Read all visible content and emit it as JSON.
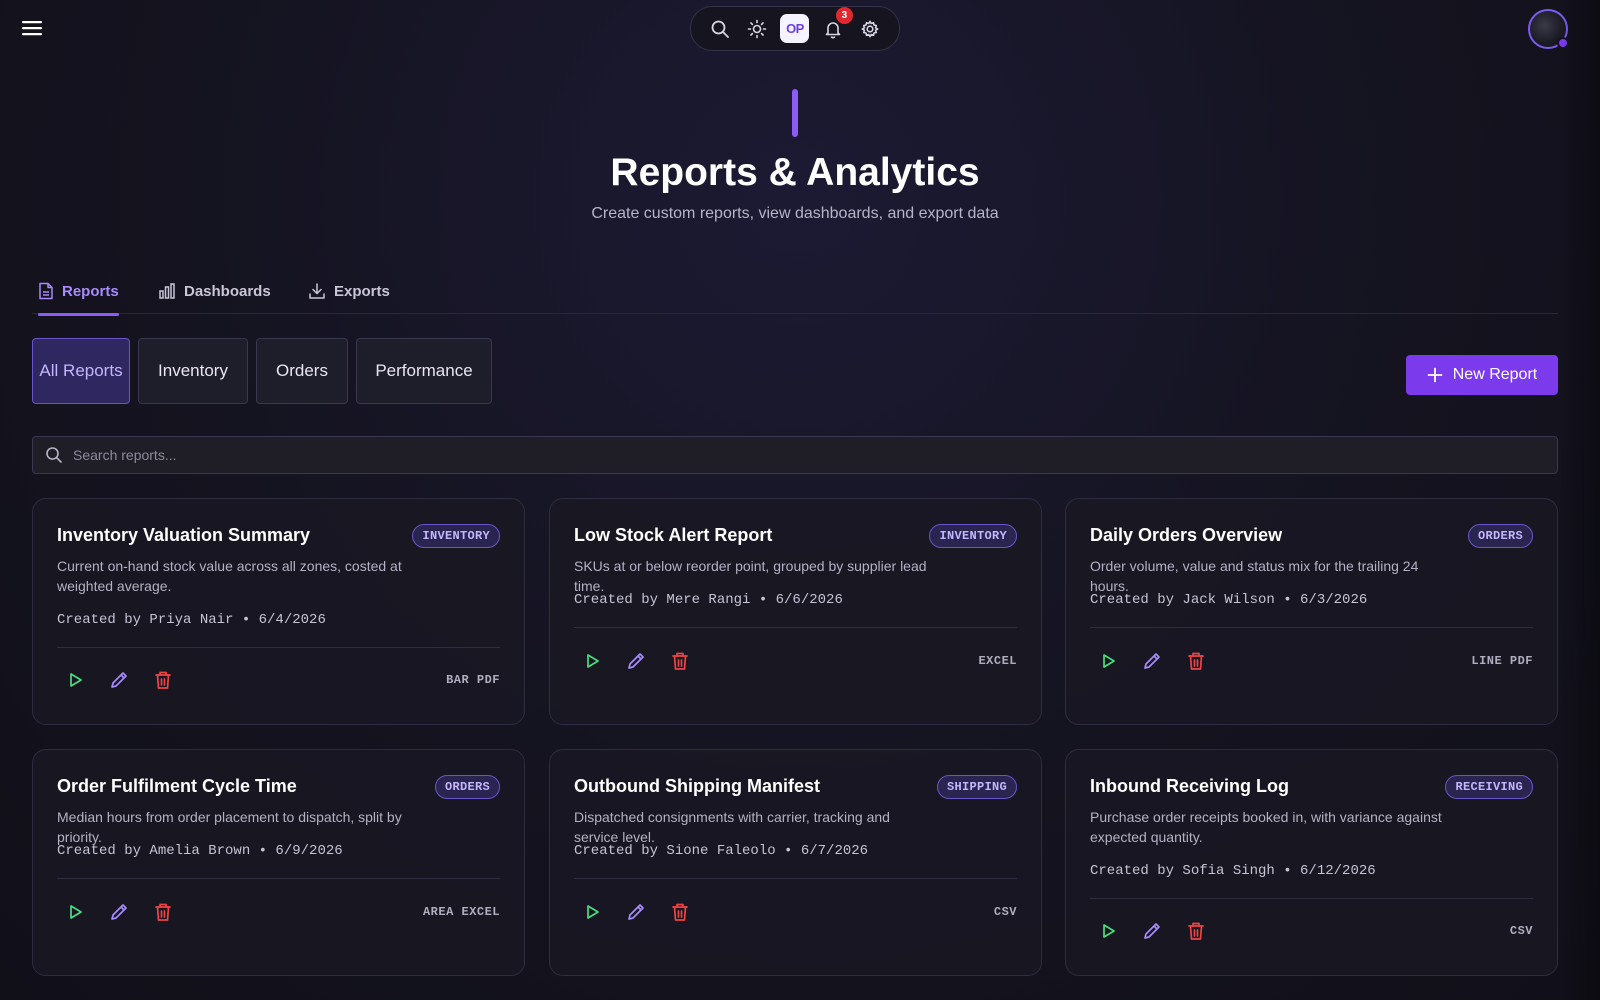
{
  "header": {
    "title": "Reports & Analytics",
    "subtitle": "Create custom reports, view dashboards, and export data"
  },
  "toolbar": {
    "logo_text": "OP",
    "notification_count": "3"
  },
  "tabs": [
    {
      "label": "Reports",
      "icon": "document-icon",
      "active": true
    },
    {
      "label": "Dashboards",
      "icon": "bar-chart-icon",
      "active": false
    },
    {
      "label": "Exports",
      "icon": "download-icon",
      "active": false
    }
  ],
  "filters": [
    {
      "label": "All Reports",
      "active": true
    },
    {
      "label": "Inventory",
      "active": false
    },
    {
      "label": "Orders",
      "active": false
    },
    {
      "label": "Performance",
      "active": false
    }
  ],
  "new_report_label": "New Report",
  "search": {
    "placeholder": "Search reports..."
  },
  "cards": [
    {
      "title": "Inventory Valuation Summary",
      "badge": "INVENTORY",
      "description": "Current on-hand stock value across all zones, costed at weighted average.",
      "meta": "Created by Priya Nair • 6/4/2026",
      "formats": "BAR PDF"
    },
    {
      "title": "Low Stock Alert Report",
      "badge": "INVENTORY",
      "description": "SKUs at or below reorder point, grouped by supplier lead time.",
      "meta": "Created by Mere Rangi • 6/6/2026",
      "formats": "EXCEL"
    },
    {
      "title": "Daily Orders Overview",
      "badge": "ORDERS",
      "description": "Order volume, value and status mix for the trailing 24 hours.",
      "meta": "Created by Jack Wilson • 6/3/2026",
      "formats": "LINE PDF"
    },
    {
      "title": "Order Fulfilment Cycle Time",
      "badge": "ORDERS",
      "description": "Median hours from order placement to dispatch, split by priority.",
      "meta": "Created by Amelia Brown • 6/9/2026",
      "formats": "AREA EXCEL"
    },
    {
      "title": "Outbound Shipping Manifest",
      "badge": "SHIPPING",
      "description": "Dispatched consignments with carrier, tracking and service level.",
      "meta": "Created by Sione Faleolo • 6/7/2026",
      "formats": "CSV"
    },
    {
      "title": "Inbound Receiving Log",
      "badge": "RECEIVING",
      "description": "Purchase order receipts booked in, with variance against expected quantity.",
      "meta": "Created by Sofia Singh • 6/12/2026",
      "formats": "CSV"
    }
  ],
  "colors": {
    "accent": "#7c3aed",
    "run_icon": "#4ade80",
    "edit_icon": "#a78bfa",
    "delete_icon": "#ef4444"
  }
}
